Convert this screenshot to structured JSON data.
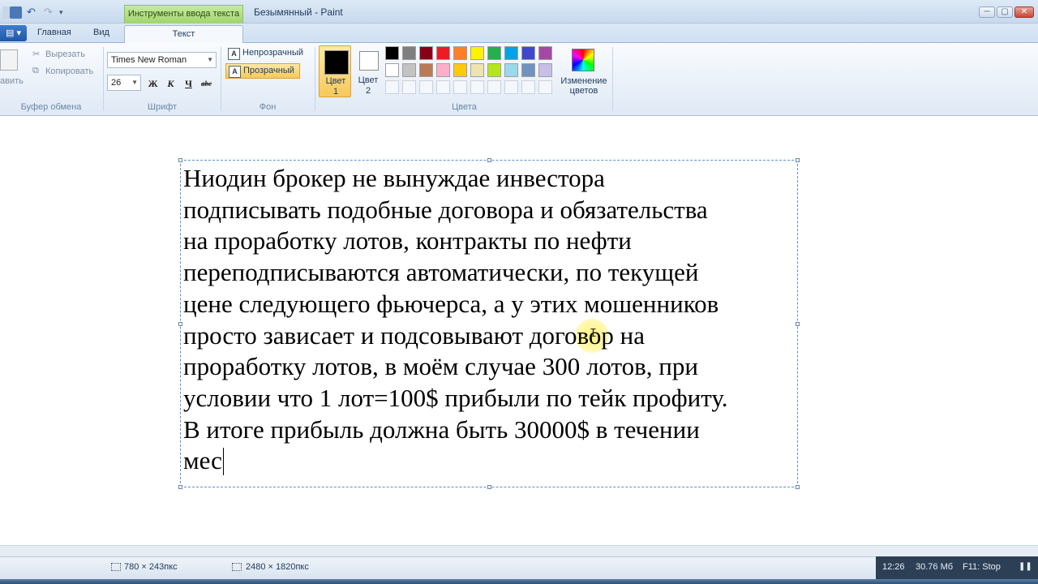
{
  "window": {
    "app_title": "Безымянный - Paint",
    "contextual_tab_header": "Инструменты ввода текста",
    "controls": {
      "minimize": "─",
      "maximize": "▢",
      "close": "✕"
    }
  },
  "tabs": {
    "home": "Главная",
    "view": "Вид",
    "text": "Текст"
  },
  "ribbon": {
    "clipboard": {
      "paste": "авить",
      "cut": "Вырезать",
      "copy": "Копировать",
      "label": "Буфер обмена"
    },
    "font": {
      "family": "Times New Roman",
      "size": "26",
      "bold": "Ж",
      "italic": "К",
      "underline": "Ч",
      "strike": "abc",
      "label": "Шрифт"
    },
    "background": {
      "opaque": "Непрозрачный",
      "transparent": "Прозрачный",
      "label": "Фон"
    },
    "colors": {
      "color1_label_line1": "Цвет",
      "color1_label_line2": "1",
      "color2_label_line1": "Цвет",
      "color2_label_line2": "2",
      "edit_line1": "Изменение",
      "edit_line2": "цветов",
      "label": "Цвета",
      "color1": "#000000",
      "color2": "#ffffff",
      "palette_row1": [
        "#000000",
        "#7f7f7f",
        "#880015",
        "#ed1c24",
        "#ff7f27",
        "#fff200",
        "#22b14c",
        "#00a2e8",
        "#3f48cc",
        "#a349a4"
      ],
      "palette_row2": [
        "#ffffff",
        "#c3c3c3",
        "#b97a57",
        "#ffaec9",
        "#ffc90e",
        "#efe4b0",
        "#b5e61d",
        "#99d9ea",
        "#7092be",
        "#c8bfe7"
      ]
    }
  },
  "canvas": {
    "text": "Ниодин брокер не вынуждае инвестора\nподписывать подобные договора и обязательства\nна проработку лотов, контракты по нефти\nпереподписываются автоматически, по текущей\nцене следующего фьючерса, а у этих мошенников\nпросто зависает и подсовывают договор на\nпроработку лотов, в моём случае 300 лотов, при\nусловии что 1 лот=100$ прибыли по тейк профиту.\nВ итоге прибыль должна быть 30000$ в течении\nмес"
  },
  "status": {
    "selection_size": "780 × 243пкс",
    "image_size": "2480 × 1820пкс"
  },
  "overlay": {
    "time": "12:26",
    "memory": "30.76 Мб",
    "hotkey": "F11: Stop",
    "pause": "❚❚"
  }
}
